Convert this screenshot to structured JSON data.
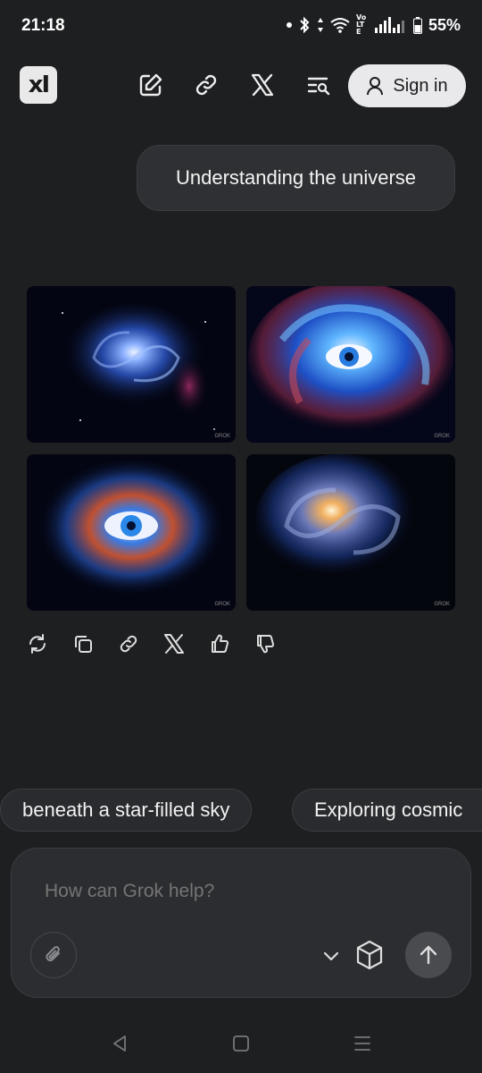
{
  "status_bar": {
    "time": "21:18",
    "volte": "Vo LTE",
    "battery": "55%",
    "icons": [
      "notification-dot-icon",
      "bluetooth-icon",
      "data-arrows-icon",
      "wifi-icon",
      "signal-icon",
      "battery-icon"
    ]
  },
  "header": {
    "logo_text": "xI",
    "icons": [
      "new-chat-icon",
      "link-icon",
      "x-logo-icon",
      "search-history-icon"
    ],
    "sign_in": "Sign in"
  },
  "conversation": {
    "user_message": "Understanding the universe",
    "images": [
      {
        "name": "spiral-galaxy-blue",
        "watermark": "GROK"
      },
      {
        "name": "galaxy-eye-swirl",
        "watermark": "GROK"
      },
      {
        "name": "cosmic-eye-nebula",
        "watermark": "GROK"
      },
      {
        "name": "spiral-galaxy-gold-core",
        "watermark": "GROK"
      }
    ],
    "actions": [
      "regenerate-icon",
      "copy-icon",
      "link-icon",
      "x-share-icon",
      "thumbs-up-icon",
      "thumbs-down-icon"
    ]
  },
  "suggestions": [
    "beneath a star-filled sky",
    "Exploring cosmic"
  ],
  "composer": {
    "placeholder": "How can Grok help?"
  },
  "colors": {
    "background": "#1e1f21",
    "bubble": "#2f3033",
    "signin_bg": "#e9e9eb",
    "send_bg": "#4a4b4f"
  }
}
